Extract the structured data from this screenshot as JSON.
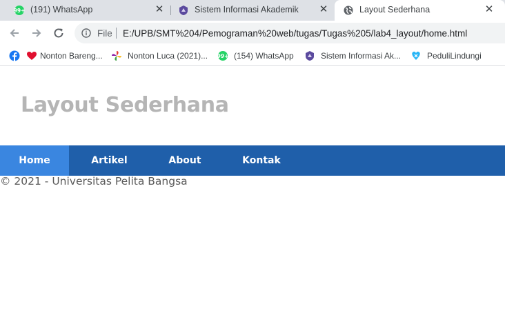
{
  "browser": {
    "tabs": [
      {
        "title": "(191) WhatsApp",
        "favicon": "whatsapp-icon"
      },
      {
        "title": "Sistem Informasi Akademik",
        "favicon": "university-crest-icon"
      },
      {
        "title": "Layout Sederhana",
        "favicon": "globe-icon",
        "active": true
      }
    ],
    "close_glyph": "✕",
    "address_bar": {
      "scheme_label": "File",
      "url": "E:/UPB/SMT%204/Pemograman%20web/tugas/Tugas%205/lab4_layout/home.html"
    },
    "bookmarks": [
      {
        "label": "",
        "icon": "facebook-icon"
      },
      {
        "label": "Nonton Bareng...",
        "icon": "heart-icon"
      },
      {
        "label": "Nonton Luca (2021)...",
        "icon": "pinwheel-icon"
      },
      {
        "label": "(154) WhatsApp",
        "icon": "whatsapp-icon"
      },
      {
        "label": "Sistem Informasi Ak...",
        "icon": "university-crest-icon"
      },
      {
        "label": "PeduliLindungi",
        "icon": "pedulilindungi-icon"
      }
    ]
  },
  "page": {
    "site_title": "Layout Sederhana",
    "nav": [
      {
        "label": "Home",
        "active": true
      },
      {
        "label": "Artikel"
      },
      {
        "label": "About"
      },
      {
        "label": "Kontak"
      }
    ],
    "footer": "© 2021 - Universitas Pelita Bangsa"
  },
  "colors": {
    "tabstrip_bg": "#dee1e6",
    "navbar_bg": "#1f5faa",
    "nav_active_bg": "#3a86e0",
    "site_title": "#b5b5b5",
    "whatsapp_green": "#25d366"
  }
}
